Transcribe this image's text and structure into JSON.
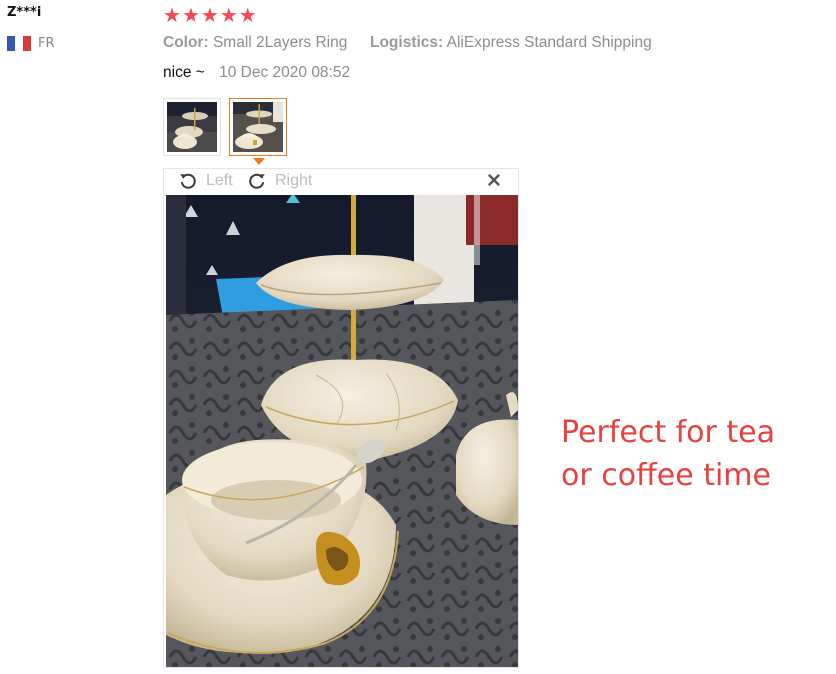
{
  "user": {
    "name": "Z***i",
    "country": "FR"
  },
  "review": {
    "rating_stars": 5,
    "rating_max": 5,
    "star_color": "#f44b52",
    "color_label": "Color:",
    "color_value": "Small 2Layers Ring",
    "logistics_label": "Logistics:",
    "logistics_value": "AliExpress Standard Shipping",
    "comment": "nice ~",
    "date": "10 Dec 2020 08:52"
  },
  "thumbnails": {
    "count": 2,
    "selected_index": 1,
    "accent_color": "#f27a1a"
  },
  "viewer": {
    "rotate_left_label": "Left",
    "rotate_right_label": "Right",
    "rotate_left_icon": "rotate-left-icon",
    "rotate_right_icon": "rotate-right-icon",
    "close_icon": "close-icon"
  },
  "overlay": {
    "line1": "Perfect for tea",
    "line2": "or coffee time",
    "color": "#e8413f"
  }
}
